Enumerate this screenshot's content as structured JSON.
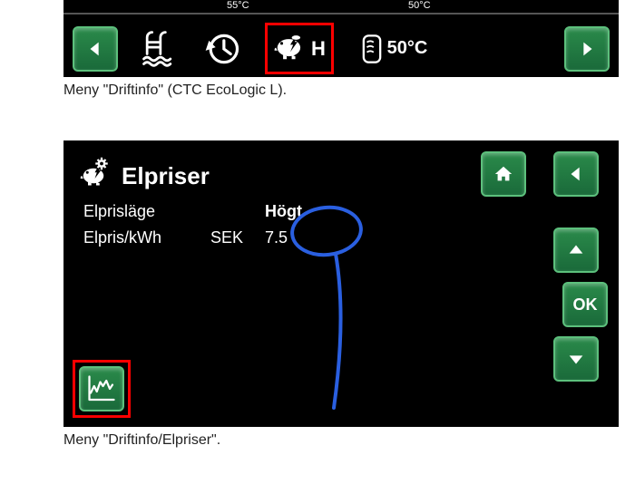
{
  "panel1": {
    "temp_small_1": "55°C",
    "temp_small_2": "50°C",
    "piggy_label": "H",
    "tank_temp": "50°C",
    "caption": "Meny \"Driftinfo\" (CTC EcoLogic L)."
  },
  "panel2": {
    "title": "Elpriser",
    "row1_label": "Elprisläge",
    "row1_value": "Högt",
    "row2_label": "Elpris/kWh",
    "row2_unit": "SEK",
    "row2_value": "7.5",
    "ok_label": "OK",
    "caption": "Meny \"Driftinfo/Elpriser\"."
  }
}
